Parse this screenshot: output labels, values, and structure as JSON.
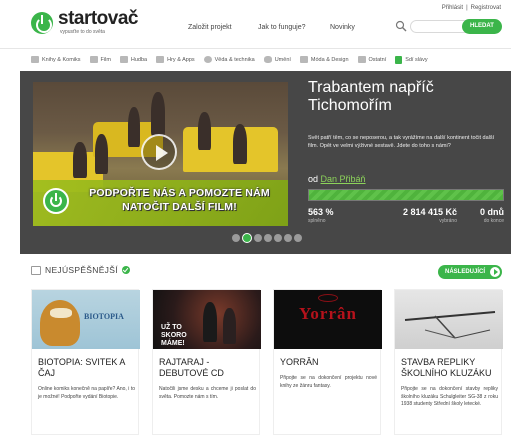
{
  "header": {
    "logo_name": "startovač",
    "logo_tagline": "vypusťte to do světa",
    "login": "Přihlásit",
    "register": "Registrovat",
    "nav": [
      "Založit projekt",
      "Jak to funguje?",
      "Novinky"
    ],
    "search_placeholder": "",
    "search_button": "HLEDAT"
  },
  "categories": [
    {
      "label": "Knihy & Komiks",
      "icon": "book-icon"
    },
    {
      "label": "Film",
      "icon": "film-icon"
    },
    {
      "label": "Hudba",
      "icon": "music-icon"
    },
    {
      "label": "Hry & Apps",
      "icon": "gamepad-icon"
    },
    {
      "label": "Věda & technika",
      "icon": "science-icon"
    },
    {
      "label": "Umění",
      "icon": "art-icon"
    },
    {
      "label": "Móda & Design",
      "icon": "fashion-icon"
    },
    {
      "label": "Ostatní",
      "icon": "other-icon"
    },
    {
      "label": "Sdí slávy",
      "icon": "flag-icon"
    }
  ],
  "hero": {
    "title": "Trabantem napříč Tichomořím",
    "description": "Svět patří těm, co se neposerou, a tak vyrážíme na další kontinent točit další film. Opět ve velmi výživné sestavě. Jdete do toho s námi?",
    "author_prefix": "od",
    "author_name": "Dan Přibáň",
    "banner_text": "PODPOŘTE NÁS A POMOZTE NÁM NATOČIT DALŠÍ FILM!",
    "progress_percent": 563,
    "stats": [
      {
        "value": "563 %",
        "label": "splněno"
      },
      {
        "value": "2 814 415 Kč",
        "label": "vybráno"
      },
      {
        "value": "0 dnů",
        "label": "do konce"
      }
    ],
    "slide_count": 7,
    "active_slide": 2
  },
  "section": {
    "title": "NEJÚSPĚŠNĚJŠÍ",
    "next_button": "NÁSLEDUJÍCÍ"
  },
  "projects": [
    {
      "title": "BIOTOPIA: SVITEK A ČAJ",
      "desc": "Online komiks konečně na papíře? Ano, i to je možné! Podpořte vydání Biotopie.",
      "img_text": "BIOTOPIA"
    },
    {
      "title": "RAJTARAJ - DEBUTOVÉ CD",
      "desc": "Natočili jsme desku a chceme ji poslat do světa. Pomozte nám s tím.",
      "img_text": "UŽ TO SKORO MÁME!"
    },
    {
      "title": "YORRÂN",
      "desc": "Připojte se na dokončení projektu nové knihy ze žánru fantasy.",
      "img_text": "Yorrân"
    },
    {
      "title": "STAVBA REPLIKY ŠKOLNÍHO KLUZÁKU",
      "desc": "Připojte se na dokončení stavby repliky školního kluzáku Schulgleiter SG-38 z roku 1938 studenty Střední školy letecké.",
      "img_text": ""
    }
  ],
  "colors": {
    "accent": "#3bb54a",
    "hero_bg": "#474747"
  }
}
